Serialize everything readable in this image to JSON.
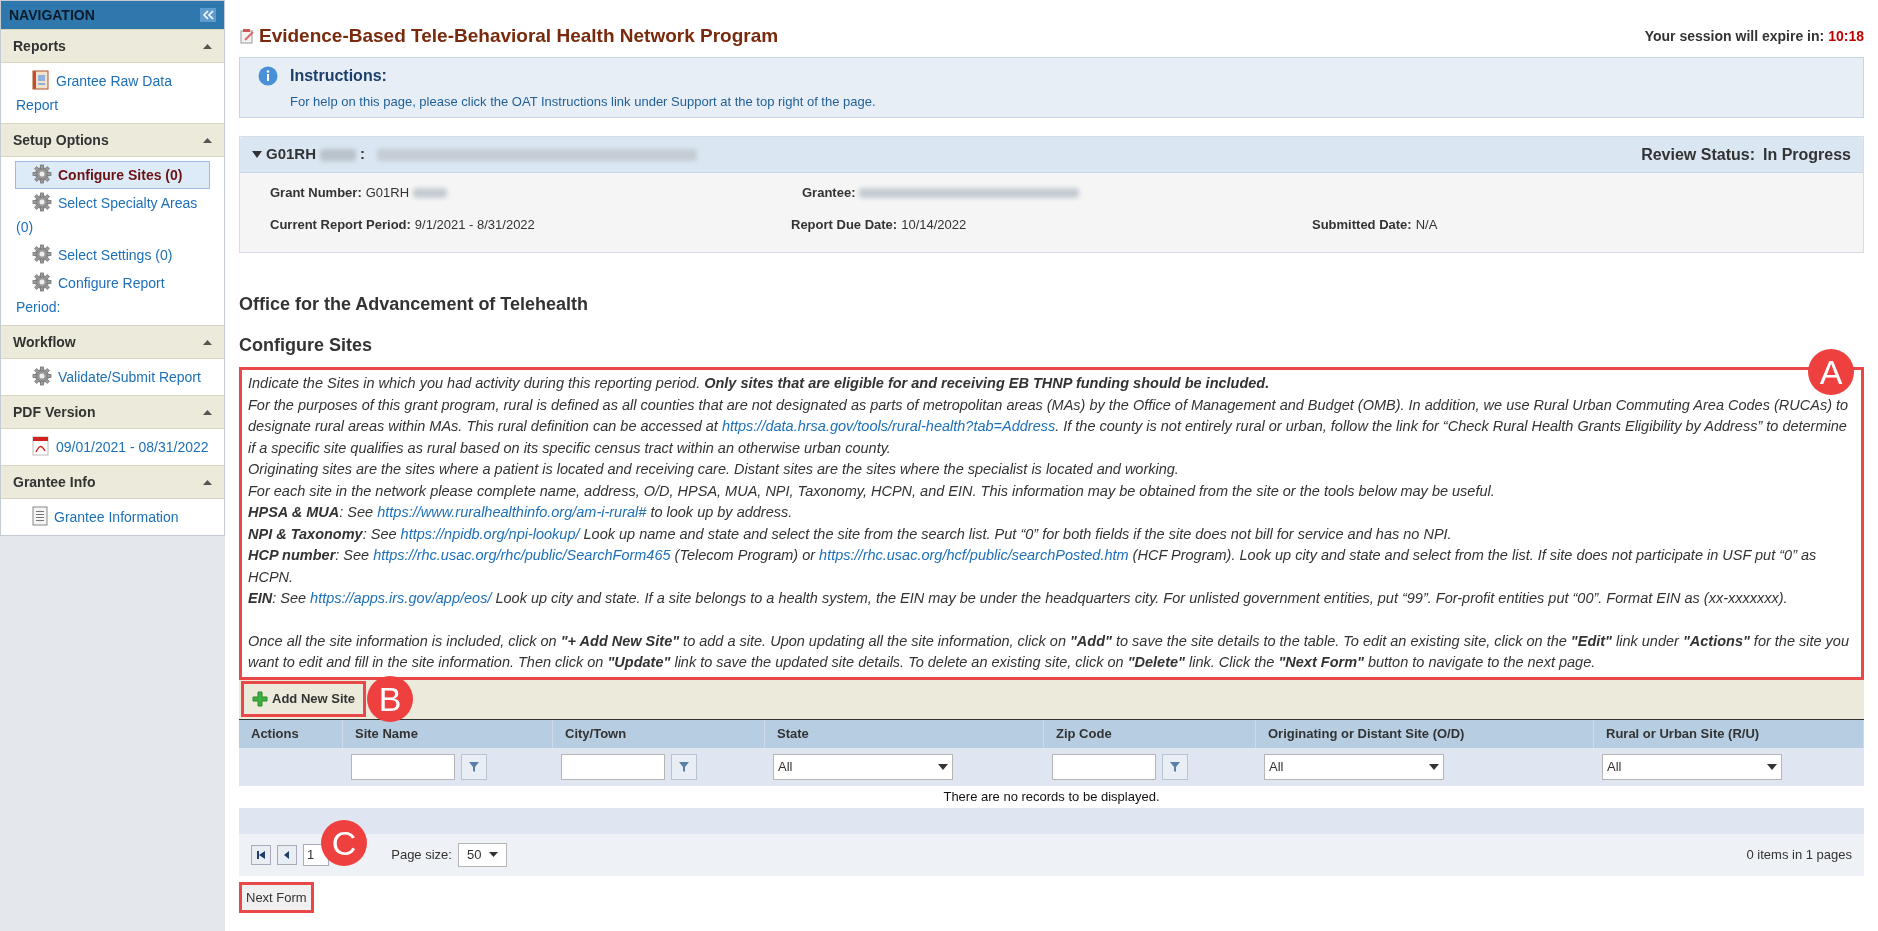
{
  "sidebar": {
    "title": "NAVIGATION",
    "sections": [
      {
        "title": "Reports",
        "expanded": true,
        "items": [
          {
            "kind": "report",
            "label": "Grantee Raw Data Report",
            "selected": false
          }
        ]
      },
      {
        "title": "Setup Options",
        "expanded": true,
        "items": [
          {
            "kind": "gear",
            "label": "Configure Sites (0)",
            "selected": true
          },
          {
            "kind": "gear",
            "label": "Select Specialty Areas (0)",
            "selected": false
          },
          {
            "kind": "gear",
            "label": "Select Settings (0)",
            "selected": false
          },
          {
            "kind": "gear",
            "label": "Configure Report Period:",
            "selected": false
          }
        ]
      },
      {
        "title": "Workflow",
        "expanded": true,
        "items": [
          {
            "kind": "gear",
            "label": "Validate/Submit Report",
            "selected": false
          }
        ]
      },
      {
        "title": "PDF Version",
        "expanded": true,
        "items": [
          {
            "kind": "pdf",
            "label": "09/01/2021 - 08/31/2022",
            "selected": false
          }
        ]
      },
      {
        "title": "Grantee Info",
        "expanded": true,
        "items": [
          {
            "kind": "document",
            "label": "Grantee Information",
            "selected": false
          }
        ]
      }
    ]
  },
  "header": {
    "title": "Evidence-Based Tele-Behavioral Health Network Program",
    "session_label": "Your session will expire in:",
    "session_time": "10:18"
  },
  "instructions": {
    "title": "Instructions:",
    "text": "For help on this page, please click the OAT Instructions link under Support at the top right of the page."
  },
  "grant_panel": {
    "expanded": true,
    "grant_id": "G01RH",
    "separator": ":",
    "review_label": "Review Status:",
    "review_value": "In Progress",
    "rows": [
      [
        {
          "label": "Grant Number:",
          "value": "G01RH",
          "redacted": true
        },
        {
          "label": "Grantee:",
          "redacted": true
        }
      ],
      [
        {
          "label": "Current Report Period:",
          "value": "9/1/2021 - 8/31/2022"
        },
        {
          "label": "Report Due Date:",
          "value": "10/14/2022"
        },
        {
          "label": "Submitted Date:",
          "value": "N/A"
        }
      ]
    ]
  },
  "office_title": "Office for the Advancement of Telehealth",
  "page_title": "Configure Sites",
  "guidance": {
    "callout": "A",
    "paragraphs": [
      {
        "parts": [
          {
            "kind": "text",
            "text": "Indicate the Sites in which you had activity during this reporting period. **Only sites that are eligible for and receiving EB THNP funding should be included.**"
          }
        ]
      },
      {
        "parts": [
          {
            "kind": "text",
            "text": "For the purposes of this grant program, rural is defined as all counties that are not designated as parts of metropolitan areas (MAs) by the Office of Management and Budget (OMB). In addition, we use Rural Urban Commuting Area Codes (RUCAs) to designate rural areas within MAs. This rural definition can be accessed at "
          },
          {
            "kind": "link",
            "text": "https://data.hrsa.gov/tools/rural-health?tab=Address"
          },
          {
            "kind": "text",
            "text": ". If the county is not entirely rural or urban, follow the link for “Check Rural Health Grants Eligibility by Address” to determine if a specific site qualifies as rural based on its specific census tract within an otherwise urban county."
          }
        ]
      },
      {
        "parts": [
          {
            "kind": "text",
            "text": "Originating sites are the sites where a patient is located and receiving care. Distant sites are the sites where the specialist is located and working."
          }
        ]
      },
      {
        "parts": [
          {
            "kind": "text",
            "text": "For each site in the network please complete name, address, O/D, HPSA, MUA, NPI, Taxonomy, HCPN, and EIN. This information may be obtained from the site or the tools below may be useful."
          }
        ]
      },
      {
        "parts": [
          {
            "kind": "text",
            "text": "**HPSA & MUA**: See "
          },
          {
            "kind": "link",
            "text": "https://www.ruralhealthinfo.org/am-i-rural#"
          },
          {
            "kind": "text",
            "text": " to look up by address."
          }
        ]
      },
      {
        "parts": [
          {
            "kind": "text",
            "text": "**NPI & Taxonomy**: See "
          },
          {
            "kind": "link",
            "text": "https://npidb.org/npi-lookup/"
          },
          {
            "kind": "text",
            "text": " Look up name and state and select the site from the search list. Put “0” for both fields if the site does not bill for service and has no NPI."
          }
        ]
      },
      {
        "parts": [
          {
            "kind": "text",
            "text": "**HCP number**: See "
          },
          {
            "kind": "link",
            "text": "https://rhc.usac.org/rhc/public/SearchForm465"
          },
          {
            "kind": "text",
            "text": " (Telecom Program) or "
          },
          {
            "kind": "link",
            "text": "https://rhc.usac.org/hcf/public/searchPosted.htm"
          },
          {
            "kind": "text",
            "text": " (HCF Program). Look up city and state and select from the list. If site does not participate in USF put “0” as HCPN."
          }
        ]
      },
      {
        "parts": [
          {
            "kind": "text",
            "text": "**EIN**: See "
          },
          {
            "kind": "link",
            "text": "https://apps.irs.gov/app/eos/"
          },
          {
            "kind": "text",
            "text": " Look up city and state. If a site belongs to a health system, the EIN may be under the headquarters city. For unlisted government entities, put “99”. For-profit entities put “00”. Format EIN as (xx-xxxxxxx)."
          }
        ]
      },
      {
        "gap_before": true,
        "parts": [
          {
            "kind": "text",
            "text": "Once all the site information is included, click on **\"+ Add New Site\"** to add a site. Upon updating all the site information, click on **\"Add\"** to save the site details to the table. To edit an existing site, click on the **\"Edit\"** link under **\"Actions\"** for the site you want to edit and fill in the site information. Then click on **\"Update\"** link to save the updated site details. To delete an existing site, click on **\"Delete\"** link. Click the **\"Next Form\"** button to navigate to the next page."
          }
        ]
      }
    ]
  },
  "toolbar": {
    "add_button": "Add New Site",
    "callout": "B"
  },
  "table": {
    "columns": [
      {
        "title": "Actions",
        "kind": "none"
      },
      {
        "title": "Site Name",
        "kind": "text"
      },
      {
        "title": "City/Town",
        "kind": "text"
      },
      {
        "title": "State",
        "kind": "select",
        "value": "All"
      },
      {
        "title": "Zip Code",
        "kind": "text"
      },
      {
        "title": "Originating or Distant Site (O/D)",
        "kind": "select",
        "value": "All"
      },
      {
        "title": "Rural or Urban Site (R/U)",
        "kind": "select",
        "value": "All"
      }
    ],
    "empty_message": "There are no records to be displayed."
  },
  "pager": {
    "page": "1",
    "page_size_label": "Page size:",
    "page_size": "50",
    "summary": "0 items in 1 pages"
  },
  "next_button": {
    "label": "Next Form",
    "callout": "C"
  }
}
